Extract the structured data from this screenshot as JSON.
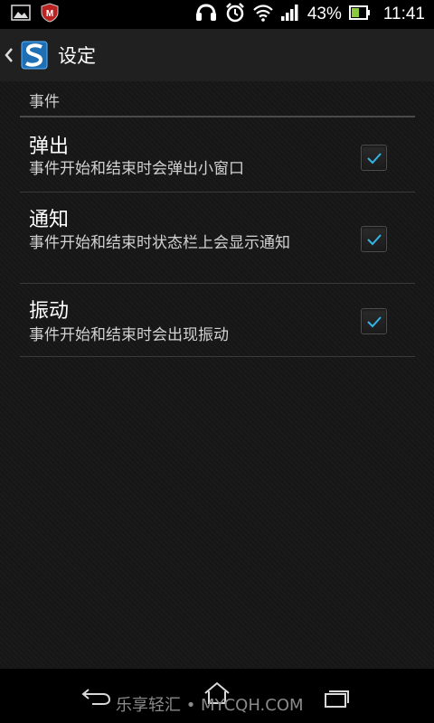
{
  "status_bar": {
    "battery_percent": "43%",
    "time": "11:41",
    "icons": [
      "gallery-icon",
      "mcafee-icon",
      "headset-icon",
      "alarm-icon",
      "wifi-icon",
      "signal-icon",
      "battery-icon"
    ]
  },
  "action_bar": {
    "title": "设定",
    "icons": [
      "back-arrow-icon",
      "app-logo-icon"
    ]
  },
  "settings": {
    "section_header": "事件",
    "items": [
      {
        "title": "弹出",
        "summary": "事件开始和结束时会弹出小窗口",
        "checked": true
      },
      {
        "title": "通知",
        "summary": "事件开始和结束时状态栏上会显示通知",
        "checked": true
      },
      {
        "title": "振动",
        "summary": "事件开始和结束时会出现振动",
        "checked": true
      }
    ]
  },
  "nav_bar": {
    "icons": [
      "back-icon",
      "home-icon",
      "recent-apps-icon"
    ],
    "watermark": "乐享轻汇 • MYCQH.COM"
  },
  "colors": {
    "check_blue": "#33b5e5",
    "background": "#161616",
    "action_bar": "#202020"
  }
}
